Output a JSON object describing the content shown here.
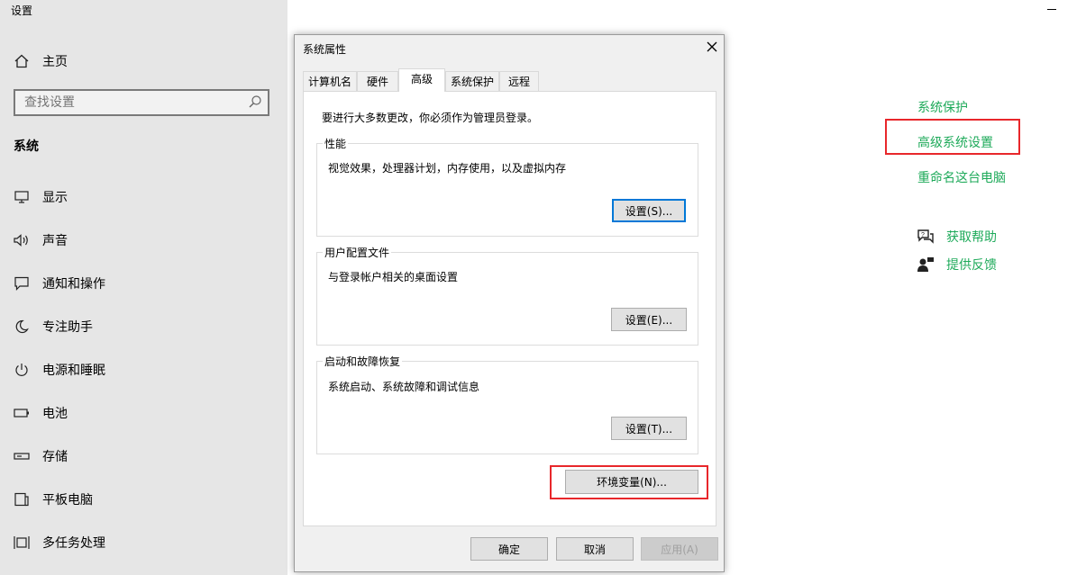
{
  "app_title": "设置",
  "sidebar": {
    "home_label": "主页",
    "search_placeholder": "查找设置",
    "section_title": "系统",
    "items": [
      {
        "label": "显示",
        "icon": "display-icon"
      },
      {
        "label": "声音",
        "icon": "sound-icon"
      },
      {
        "label": "通知和操作",
        "icon": "notification-icon"
      },
      {
        "label": "专注助手",
        "icon": "moon-icon"
      },
      {
        "label": "电源和睡眠",
        "icon": "power-icon"
      },
      {
        "label": "电池",
        "icon": "battery-icon"
      },
      {
        "label": "存储",
        "icon": "storage-icon"
      },
      {
        "label": "平板电脑",
        "icon": "tablet-icon"
      },
      {
        "label": "多任务处理",
        "icon": "multitask-icon"
      }
    ]
  },
  "related": {
    "system_protection": "系统保护",
    "advanced_settings": "高级系统设置",
    "rename_pc": "重命名这台电脑",
    "get_help": "获取帮助",
    "feedback": "提供反馈"
  },
  "dialog": {
    "title": "系统属性",
    "tabs": [
      "计算机名",
      "硬件",
      "高级",
      "系统保护",
      "远程"
    ],
    "active_tab": "高级",
    "admin_note": "要进行大多数更改，你必须作为管理员登录。",
    "performance": {
      "label": "性能",
      "desc": "视觉效果，处理器计划，内存使用，以及虚拟内存",
      "button": "设置(S)..."
    },
    "profiles": {
      "label": "用户配置文件",
      "desc": "与登录帐户相关的桌面设置",
      "button": "设置(E)..."
    },
    "startup": {
      "label": "启动和故障恢复",
      "desc": "系统启动、系统故障和调试信息",
      "button": "设置(T)..."
    },
    "env_button": "环境变量(N)...",
    "ok": "确定",
    "cancel": "取消",
    "apply": "应用(A)"
  },
  "colors": {
    "accent_link": "#1eaa5a",
    "highlight": "#e8272b",
    "focus": "#0078d7"
  }
}
